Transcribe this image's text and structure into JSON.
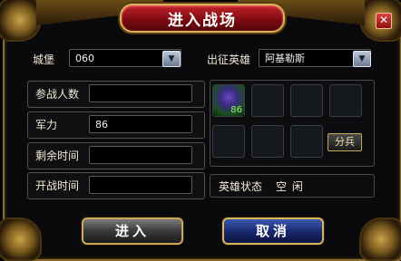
{
  "dialog": {
    "title": "进入战场",
    "close_glyph": "✕"
  },
  "castle": {
    "label": "城堡",
    "value": "060"
  },
  "hero_select": {
    "label": "出征英雄",
    "value": "阿基勒斯"
  },
  "fields": [
    {
      "label": "参战人数",
      "value": ""
    },
    {
      "label": "军力",
      "value": "86"
    },
    {
      "label": "剩余时间",
      "value": ""
    },
    {
      "label": "开战时间",
      "value": ""
    }
  ],
  "hero_slot": {
    "level": "86"
  },
  "troops_button": "分兵",
  "hero_status": {
    "label": "英雄状态",
    "value": "空 闲"
  },
  "buttons": {
    "enter": "进入",
    "cancel": "取消"
  },
  "icons": {
    "dropdown": "▼"
  }
}
